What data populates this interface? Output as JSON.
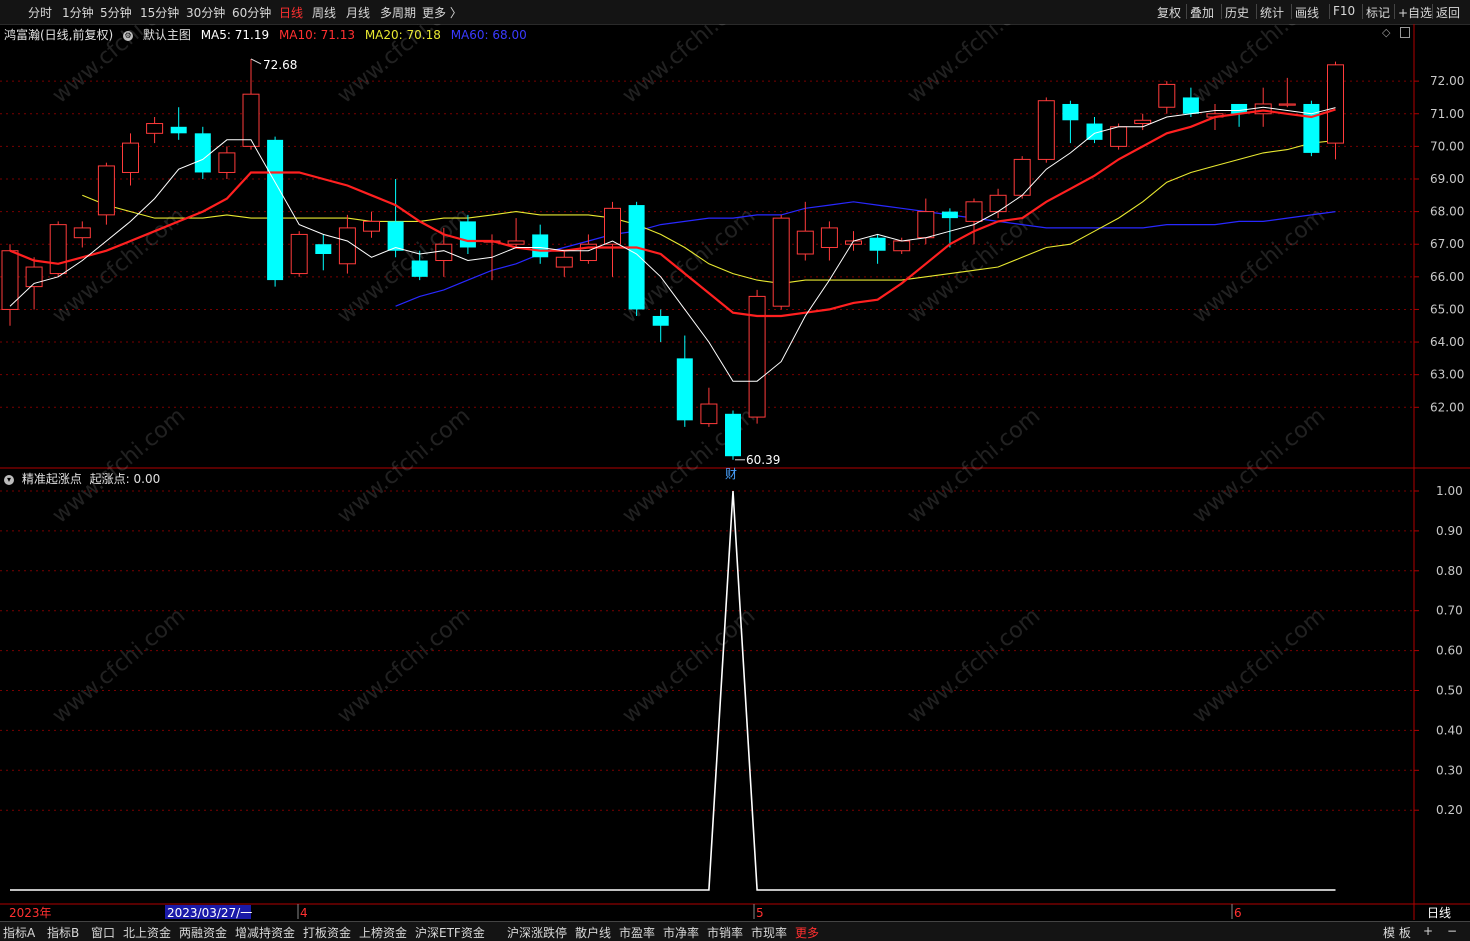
{
  "topbar": {
    "periods": [
      "分时",
      "1分钟",
      "5分钟",
      "15分钟",
      "30分钟",
      "60分钟",
      "日线",
      "周线",
      "月线",
      "多周期",
      "更多 〉"
    ],
    "active_period": "日线",
    "right_buttons": [
      "复权",
      "叠加",
      "历史",
      "统计",
      "画线",
      "F10",
      "标记",
      "+自选",
      "返回"
    ]
  },
  "main_legend": {
    "stock": "鸿富瀚(日线,前复权)",
    "template": "默认主图",
    "ma5": "MA5: 71.19",
    "ma10": "MA10: 71.13",
    "ma20": "MA20: 70.18",
    "ma60": "MA60: 68.00"
  },
  "indicator_legend": {
    "name": "精准起涨点",
    "value": "起涨点: 0.00"
  },
  "annotations": {
    "high": "72.68",
    "low": "60.39",
    "low_marker": "财"
  },
  "watermark": "www.cfchi.com",
  "time_axis": {
    "year": "2023年",
    "cursor_date": "2023/03/27/一",
    "months": [
      "4",
      "5",
      "6"
    ],
    "period_label": "日线"
  },
  "bottombar": {
    "tabs": [
      "指标A",
      "指标B",
      "窗口",
      "北上资金",
      "两融资金",
      "增减持资金",
      "打板资金",
      "上榜资金",
      "沪深ETF资金",
      "沪深涨跌停",
      "散户线",
      "市盈率",
      "市净率",
      "市销率",
      "市现率",
      "更多"
    ],
    "active_tab": "更多",
    "right": [
      "模 板",
      "+",
      "−"
    ]
  },
  "colors": {
    "up": "#ff3b3b",
    "down": "#00ffff",
    "ma5": "#ffffff",
    "ma10": "#ff2020",
    "ma20": "#e8e830",
    "ma60": "#2828ff",
    "grid": "#7a0000",
    "axis": "#b00000"
  },
  "chart_data": [
    {
      "type": "candlestick",
      "title": "鸿富瀚(日线,前复权)",
      "y_ticks": [
        62.0,
        63.0,
        64.0,
        65.0,
        66.0,
        67.0,
        68.0,
        69.0,
        70.0,
        71.0,
        72.0
      ],
      "ylim": [
        60.2,
        73.2
      ],
      "candles": [
        {
          "o": 65.0,
          "c": 66.8,
          "h": 67.0,
          "l": 64.5
        },
        {
          "o": 65.7,
          "c": 66.3,
          "h": 66.6,
          "l": 65.0
        },
        {
          "o": 66.1,
          "c": 67.6,
          "h": 67.7,
          "l": 66.0
        },
        {
          "o": 67.2,
          "c": 67.5,
          "h": 67.7,
          "l": 66.9
        },
        {
          "o": 67.9,
          "c": 69.4,
          "h": 69.5,
          "l": 67.6
        },
        {
          "o": 69.2,
          "c": 70.1,
          "h": 70.4,
          "l": 68.8
        },
        {
          "o": 70.4,
          "c": 70.7,
          "h": 70.9,
          "l": 70.1
        },
        {
          "o": 70.6,
          "c": 70.4,
          "h": 71.2,
          "l": 70.2
        },
        {
          "o": 70.4,
          "c": 69.2,
          "h": 70.6,
          "l": 69.0
        },
        {
          "o": 69.2,
          "c": 69.8,
          "h": 70.0,
          "l": 69.0
        },
        {
          "o": 70.0,
          "c": 71.6,
          "h": 72.68,
          "l": 69.9
        },
        {
          "o": 70.2,
          "c": 65.9,
          "h": 70.3,
          "l": 65.7
        },
        {
          "o": 66.1,
          "c": 67.3,
          "h": 67.4,
          "l": 66.0
        },
        {
          "o": 67.0,
          "c": 66.7,
          "h": 67.3,
          "l": 66.2
        },
        {
          "o": 66.4,
          "c": 67.5,
          "h": 67.9,
          "l": 66.1
        },
        {
          "o": 67.4,
          "c": 67.7,
          "h": 68.0,
          "l": 67.2
        },
        {
          "o": 67.7,
          "c": 66.8,
          "h": 69.0,
          "l": 66.6
        },
        {
          "o": 66.5,
          "c": 66.0,
          "h": 66.8,
          "l": 65.9
        },
        {
          "o": 66.5,
          "c": 67.0,
          "h": 67.5,
          "l": 66.0
        },
        {
          "o": 67.7,
          "c": 66.9,
          "h": 67.9,
          "l": 66.7
        },
        {
          "o": 67.1,
          "c": 67.1,
          "h": 67.3,
          "l": 65.9
        },
        {
          "o": 67.0,
          "c": 67.1,
          "h": 67.8,
          "l": 66.9
        },
        {
          "o": 67.3,
          "c": 66.6,
          "h": 67.6,
          "l": 66.4
        },
        {
          "o": 66.3,
          "c": 66.6,
          "h": 66.8,
          "l": 66.0
        },
        {
          "o": 66.5,
          "c": 67.0,
          "h": 67.3,
          "l": 66.4
        },
        {
          "o": 67.0,
          "c": 68.1,
          "h": 68.3,
          "l": 66.0
        },
        {
          "o": 68.2,
          "c": 65.0,
          "h": 68.3,
          "l": 64.8
        },
        {
          "o": 64.8,
          "c": 64.5,
          "h": 65.0,
          "l": 64.0
        },
        {
          "o": 63.5,
          "c": 61.6,
          "h": 64.2,
          "l": 61.4
        },
        {
          "o": 61.5,
          "c": 62.1,
          "h": 62.6,
          "l": 61.4
        },
        {
          "o": 61.8,
          "c": 60.5,
          "h": 61.9,
          "l": 60.39
        },
        {
          "o": 61.7,
          "c": 65.4,
          "h": 65.6,
          "l": 61.5
        },
        {
          "o": 65.1,
          "c": 67.8,
          "h": 67.9,
          "l": 65.0
        },
        {
          "o": 66.7,
          "c": 67.4,
          "h": 68.3,
          "l": 66.5
        },
        {
          "o": 66.9,
          "c": 67.5,
          "h": 67.7,
          "l": 66.5
        },
        {
          "o": 67.0,
          "c": 67.1,
          "h": 67.4,
          "l": 66.8
        },
        {
          "o": 67.2,
          "c": 66.8,
          "h": 67.3,
          "l": 66.4
        },
        {
          "o": 66.8,
          "c": 67.1,
          "h": 67.2,
          "l": 66.7
        },
        {
          "o": 67.2,
          "c": 68.0,
          "h": 68.4,
          "l": 67.0
        },
        {
          "o": 68.0,
          "c": 67.8,
          "h": 68.1,
          "l": 66.9
        },
        {
          "o": 67.7,
          "c": 68.3,
          "h": 68.4,
          "l": 67.0
        },
        {
          "o": 68.0,
          "c": 68.5,
          "h": 68.7,
          "l": 67.8
        },
        {
          "o": 68.5,
          "c": 69.6,
          "h": 69.7,
          "l": 68.4
        },
        {
          "o": 69.6,
          "c": 71.4,
          "h": 71.5,
          "l": 69.5
        },
        {
          "o": 71.3,
          "c": 70.8,
          "h": 71.4,
          "l": 70.1
        },
        {
          "o": 70.7,
          "c": 70.2,
          "h": 70.9,
          "l": 70.1
        },
        {
          "o": 70.0,
          "c": 70.6,
          "h": 70.7,
          "l": 69.9
        },
        {
          "o": 70.7,
          "c": 70.8,
          "h": 71.0,
          "l": 70.5
        },
        {
          "o": 71.2,
          "c": 71.9,
          "h": 72.0,
          "l": 71.0
        },
        {
          "o": 71.5,
          "c": 71.0,
          "h": 71.8,
          "l": 70.9
        },
        {
          "o": 70.9,
          "c": 71.0,
          "h": 71.3,
          "l": 70.5
        },
        {
          "o": 71.3,
          "c": 71.0,
          "h": 71.3,
          "l": 70.6
        },
        {
          "o": 71.0,
          "c": 71.3,
          "h": 71.8,
          "l": 70.6
        },
        {
          "o": 71.3,
          "c": 71.3,
          "h": 72.1,
          "l": 71.2
        },
        {
          "o": 71.3,
          "c": 69.8,
          "h": 71.4,
          "l": 69.7
        },
        {
          "o": 70.1,
          "c": 72.5,
          "h": 72.6,
          "l": 69.6
        }
      ],
      "ma5": [
        65.1,
        65.8,
        66.0,
        66.5,
        67.1,
        67.7,
        68.4,
        69.3,
        69.6,
        70.2,
        70.2,
        68.9,
        67.6,
        67.3,
        67.1,
        66.6,
        66.9,
        66.7,
        66.8,
        66.5,
        66.6,
        66.9,
        66.9,
        66.8,
        66.8,
        67.1,
        66.7,
        66.0,
        65.0,
        64.0,
        62.8,
        62.8,
        63.4,
        64.8,
        65.9,
        67.1,
        67.3,
        67.1,
        67.2,
        67.4,
        67.6,
        68.0,
        68.5,
        69.3,
        69.8,
        70.4,
        70.6,
        70.6,
        70.9,
        71.0,
        71.1,
        71.1,
        71.2,
        71.1,
        71.0,
        71.19
      ],
      "ma10": [
        66.8,
        66.5,
        66.4,
        66.6,
        66.8,
        67.1,
        67.4,
        67.7,
        68.0,
        68.4,
        69.2,
        69.2,
        69.2,
        69.0,
        68.8,
        68.5,
        68.2,
        67.7,
        67.3,
        67.1,
        67.1,
        66.9,
        66.8,
        66.8,
        66.9,
        66.9,
        66.9,
        66.7,
        66.1,
        65.5,
        64.9,
        64.8,
        64.8,
        64.9,
        65.0,
        65.2,
        65.3,
        65.8,
        66.4,
        67.0,
        67.4,
        67.7,
        67.8,
        68.3,
        68.7,
        69.1,
        69.6,
        70.0,
        70.4,
        70.6,
        70.9,
        71.0,
        71.1,
        71.0,
        70.9,
        71.13
      ],
      "ma20": [
        68.5,
        68.2,
        68.0,
        67.8,
        67.8,
        67.8,
        67.9,
        67.8,
        67.8,
        67.8,
        67.8,
        67.8,
        67.7,
        67.7,
        67.7,
        67.8,
        67.8,
        67.9,
        68.0,
        67.9,
        67.9,
        67.9,
        67.8,
        67.6,
        67.3,
        66.9,
        66.4,
        66.1,
        65.9,
        65.8,
        65.9,
        65.9,
        65.9,
        65.9,
        65.9,
        66.0,
        66.1,
        66.2,
        66.3,
        66.6,
        66.9,
        67.0,
        67.4,
        67.8,
        68.3,
        68.9,
        69.2,
        69.4,
        69.6,
        69.8,
        69.9,
        70.1,
        70.18
      ],
      "ma60": [
        65.1,
        65.4,
        65.6,
        65.9,
        66.2,
        66.4,
        66.7,
        66.9,
        67.1,
        67.3,
        67.4,
        67.6,
        67.7,
        67.8,
        67.8,
        67.9,
        67.9,
        68.1,
        68.2,
        68.3,
        68.2,
        68.1,
        68.0,
        67.9,
        67.8,
        67.7,
        67.6,
        67.5,
        67.5,
        67.5,
        67.5,
        67.5,
        67.6,
        67.6,
        67.6,
        67.7,
        67.7,
        67.8,
        67.9,
        68.0
      ]
    },
    {
      "type": "line",
      "title": "精准起涨点",
      "series": [
        {
          "name": "起涨点",
          "values": [
            0,
            0,
            0,
            0,
            0,
            0,
            0,
            0,
            0,
            0,
            0,
            0,
            0,
            0,
            0,
            0,
            0,
            0,
            0,
            0,
            0,
            0,
            0,
            0,
            0,
            0,
            0,
            0,
            0,
            0,
            1,
            0,
            0,
            0,
            0,
            0,
            0,
            0,
            0,
            0,
            0,
            0,
            0,
            0,
            0,
            0,
            0,
            0,
            0,
            0,
            0,
            0,
            0,
            0,
            0,
            0
          ]
        }
      ],
      "y_ticks": [
        0.2,
        0.3,
        0.4,
        0.5,
        0.6,
        0.7,
        0.8,
        0.9,
        1.0
      ],
      "ylim": [
        0,
        1.0
      ]
    }
  ]
}
